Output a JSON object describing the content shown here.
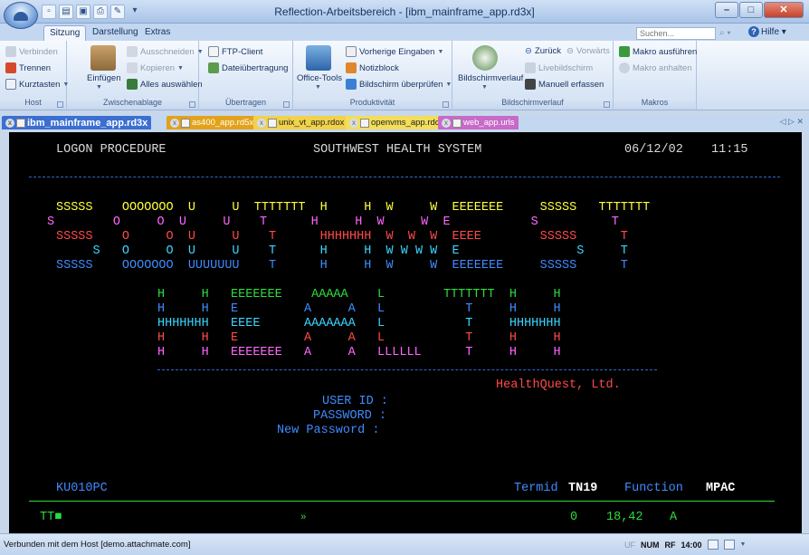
{
  "window": {
    "title": "Reflection-Arbeitsbereich - [ibm_mainframe_app.rd3x]"
  },
  "qat": {
    "icons": [
      "new-doc-icon",
      "open-icon",
      "save-icon",
      "print-icon",
      "settings-icon"
    ]
  },
  "ribbon_tabs": [
    "Sitzung",
    "Darstellung",
    "Extras"
  ],
  "search": {
    "placeholder": "Suchen..."
  },
  "help_label": "Hilfe",
  "ribbon": {
    "host": {
      "connect": "Verbinden",
      "disconnect": "Trennen",
      "shortcut_keys": "Kurztasten",
      "label": "Host"
    },
    "clipboard": {
      "paste": "Einfügen",
      "cut": "Ausschneiden",
      "copy": "Kopieren",
      "select_all": "Alles auswählen",
      "label": "Zwischenablage"
    },
    "transfer": {
      "ftp": "FTP-Client",
      "file_transfer": "Dateiübertragung",
      "label": "Übertragen"
    },
    "productivity": {
      "office_tools": "Office-Tools",
      "previous_inputs": "Vorherige Eingaben",
      "notepad": "Notizblock",
      "screen_check": "Bildschirm überprüfen",
      "label": "Produktivität"
    },
    "history": {
      "history": "Bildschirmverlauf",
      "back": "Zurück",
      "forward": "Vorwärts",
      "live_screen": "Livebildschirm",
      "manual_capture": "Manuell erfassen",
      "label": "Bildschirmverlauf"
    },
    "macros": {
      "run": "Makro ausführen",
      "stop": "Makro anhalten",
      "label": "Makros"
    }
  },
  "doc_tabs": [
    {
      "label": "ibm_mainframe_app.rd3x",
      "color": "#3b6fd0"
    },
    {
      "label": "as400_app.rd5x",
      "color": "#e3a21a"
    },
    {
      "label": "unix_vt_app.rdox",
      "color": "#f1d24a"
    },
    {
      "label": "openvms_app.rdox",
      "color": "#f2de5a"
    },
    {
      "label": "web_app.urls",
      "color": "#c76ac8"
    }
  ],
  "terminal": {
    "header_left": "LOGON PROCEDURE",
    "header_center": "SOUTHWEST HEALTH SYSTEM",
    "date": "06/12/02",
    "time": "11:15",
    "company": "HealthQuest, Ltd.",
    "user_id_label": "USER ID :",
    "password_label": "PASSWORD :",
    "new_password_label": "New Password :",
    "screen_id": "KU010PC",
    "termid_label": "Termid",
    "termid_value": "TN19",
    "function_label": "Function",
    "function_value": "MPAC",
    "oia_left": "TT■",
    "oia_center": "»",
    "oia_zero": "0",
    "oia_cursor": "18,42",
    "oia_mode": "A",
    "banner1": [
      {
        "t": "SSSSS",
        "c": "y"
      },
      {
        "t": "OOOOOOO",
        "c": "y"
      },
      {
        "t": "U",
        "c": "y"
      },
      {
        "t": "U",
        "c": "y"
      },
      {
        "t": "TTTTTTT",
        "c": "y"
      },
      {
        "t": "H",
        "c": "y"
      },
      {
        "t": "H",
        "c": "y"
      },
      {
        "t": "W",
        "c": "y"
      },
      {
        "t": "W",
        "c": "y"
      },
      {
        "t": "EEEEEEE",
        "c": "y"
      },
      {
        "t": "SSSSS",
        "c": "y"
      },
      {
        "t": "TTTTTTT",
        "c": "y"
      }
    ],
    "banner2": "S        O     O  U     U    T      H     H  W     W  E           S          T",
    "banner3": "SSSSS    O     O  U     U    T      HHHHHHH  W  W  W  EEEE        SSSSS      T",
    "banner4": "     S   O     O  U     U    T      H     H  W W W W  E                S     T",
    "banner5": "SSSSS    OOOOOOO  UUUUUUU    T      H     H  W     W  EEEEEEE     SSSSS      T",
    "hq1": "H     H   EEEEEEE    AAAAA    L        TTTTTTT  H     H",
    "hq2": "H     H   E         A     A   L           T     H     H",
    "hq3": "HHHHHHH   EEEE      AAAAAAA   L           T     HHHHHHH",
    "hq4": "H     H   E         A     A   L           T     H     H",
    "hq5": "H     H   EEEEEEE   A     A   LLLLLL      T     H     H"
  },
  "status": {
    "text": "Verbunden mit dem Host [demo.attachmate.com]",
    "uf": "UF",
    "num": "NUM",
    "rf": "RF",
    "clock": "14:00"
  }
}
